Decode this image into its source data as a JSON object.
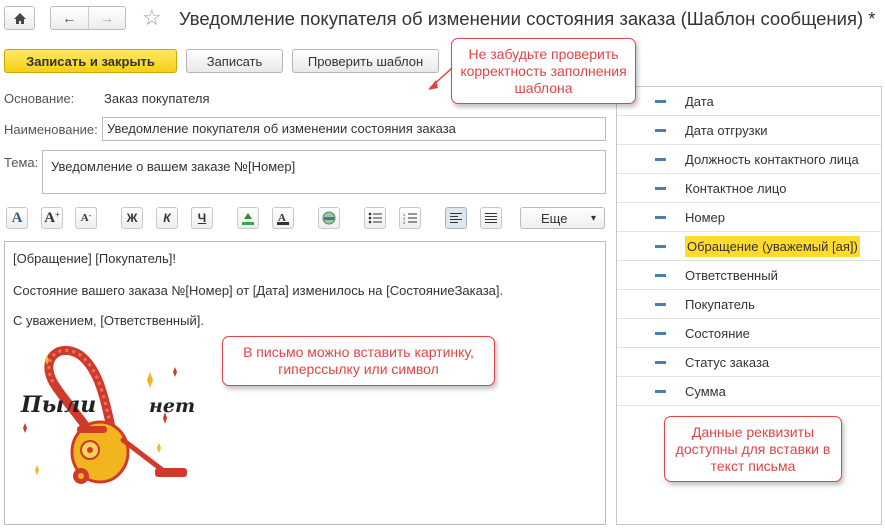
{
  "window": {
    "title": "Уведомление покупателя об изменении состояния заказа (Шаблон сообщения) *",
    "nav": {
      "back": "←",
      "forward": "→"
    }
  },
  "toolbar": {
    "save_close": "Записать и закрыть",
    "save": "Записать",
    "check": "Проверить шаблон"
  },
  "form": {
    "basis_label": "Основание:",
    "basis_value": "Заказ покупателя",
    "name_label": "Наименование:",
    "name_value": "Уведомление покупателя об изменении состояния заказа",
    "subject_label": "Тема:",
    "subject_value": "Уведомление о вашем заказе №[Номер]"
  },
  "format_toolbar": {
    "bold": "Ж",
    "italic": "К",
    "underline": "Ч",
    "more": "Еще",
    "more_arrow": "▾"
  },
  "editor": {
    "line1": "[Обращение] [Покупатель]!",
    "line2": "Состояние вашего заказа №[Номер] от [Дата] изменилось на [СостояниеЗаказа].",
    "line3": "С уважением, [Ответственный].",
    "image_text_left": "Пыли",
    "image_text_right": "нет"
  },
  "fields_list": [
    "Дата",
    "Дата отгрузки",
    "Должность контактного лица",
    "Контактное лицо",
    "Номер",
    "Обращение (уважемый [ая])",
    "Ответственный",
    "Покупатель",
    "Состояние",
    "Статус заказа",
    "Сумма"
  ],
  "selected_field_index": 5,
  "callouts": {
    "check_hint": "Не забудьте проверить корректность заполнения шаблона",
    "insert_hint": "В письмо можно вставить картинку, гиперссылку или символ",
    "fields_hint": "Данные реквизиты доступны для вставки в текст письма"
  },
  "colors": {
    "primary_button": "#f5cf16",
    "highlight": "#ffdc2c",
    "callout": "#e04545",
    "field_marker": "#4a7fb5"
  }
}
